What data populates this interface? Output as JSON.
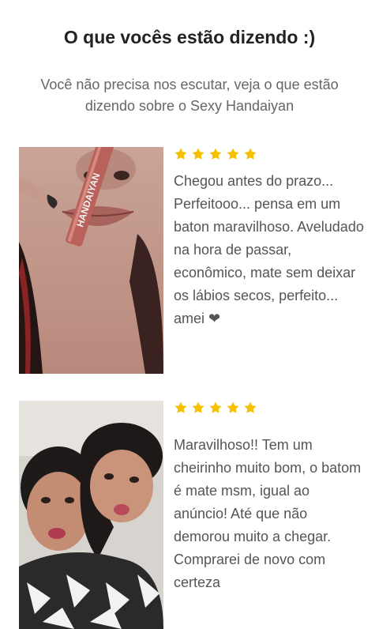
{
  "section": {
    "title": "O que vocês estão dizendo :)",
    "subtitle": "Você não precisa nos escutar, veja o que estão dizendo sobre o Sexy Handaiyan"
  },
  "colors": {
    "star": "#F6C000",
    "title": "#222222",
    "body_text": "#555555"
  },
  "reviews": [
    {
      "rating": 5,
      "text": "Chegou antes do prazo... Perfeitooo... pensa em um baton maravilhoso. Aveludado na hora de passar, econômico, mate sem deixar os lábios secos, perfeito... amei ❤",
      "photo_label": "HANDAIYAN",
      "photo_icon": "customer-photo-lipstick"
    },
    {
      "rating": 5,
      "text": "Maravilhoso!! Tem um cheirinho muito bom, o batom é mate msm, igual ao anúncio! Até que não demorou muito a chegar. Comprarei de novo com certeza",
      "photo_icon": "customer-photo-selfie"
    }
  ]
}
